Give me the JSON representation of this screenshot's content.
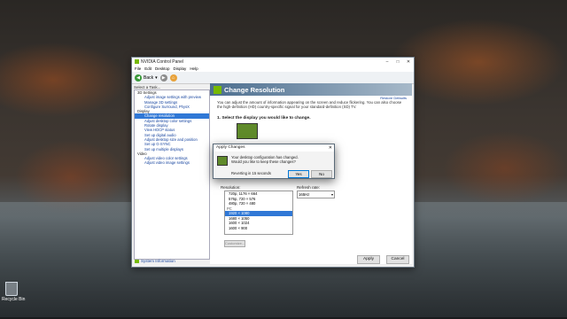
{
  "desktop": {
    "recycle_bin_label": "Recycle Bin"
  },
  "window": {
    "title": "NVIDIA Control Panel",
    "controls": [
      "–",
      "□",
      "✕"
    ],
    "menu": [
      "File",
      "Edit",
      "Desktop",
      "Display",
      "Help"
    ],
    "toolbar": {
      "back_label": "Back"
    },
    "task_label": "Select a Task...",
    "tree": [
      {
        "text": "3D Settings",
        "type": "cat"
      },
      {
        "text": "Adjust image settings with preview",
        "type": "item"
      },
      {
        "text": "Manage 3D settings",
        "type": "item"
      },
      {
        "text": "Configure Surround, PhysX",
        "type": "item"
      },
      {
        "text": "Display",
        "type": "cat"
      },
      {
        "text": "Change resolution",
        "type": "item",
        "selected": true
      },
      {
        "text": "Adjust desktop color settings",
        "type": "item"
      },
      {
        "text": "Rotate display",
        "type": "item"
      },
      {
        "text": "View HDCP status",
        "type": "item"
      },
      {
        "text": "Set up digital audio",
        "type": "item"
      },
      {
        "text": "Adjust desktop size and position",
        "type": "item"
      },
      {
        "text": "Set up G-SYNC",
        "type": "item"
      },
      {
        "text": "Set up multiple displays",
        "type": "item"
      },
      {
        "text": "Video",
        "type": "cat"
      },
      {
        "text": "Adjust video color settings",
        "type": "item"
      },
      {
        "text": "Adjust video image settings",
        "type": "item"
      }
    ],
    "system_info": "System Information",
    "page": {
      "title": "Change Resolution",
      "restore_defaults": "Restore Defaults",
      "description": "You can adjust the amount of information appearing on the screen and reduce flickering. You can also choose the high-definition (HD) country-specific signal for your standard-definition (SD) TV.",
      "step1": "1. Select the display you would like to change.",
      "resolution_label": "Resolution:",
      "refresh_label": "Refresh rate:",
      "refresh_value": "165Hz",
      "resolutions": [
        {
          "text": "720p, 1176 × 664",
          "type": "row"
        },
        {
          "text": "576p, 720 × 576",
          "type": "row"
        },
        {
          "text": "480p, 720 × 480",
          "type": "row"
        },
        {
          "text": "PC",
          "type": "hdr"
        },
        {
          "text": "1920 × 1080",
          "type": "row",
          "selected": true
        },
        {
          "text": "1680 × 1050",
          "type": "row"
        },
        {
          "text": "1600 × 1024",
          "type": "row"
        },
        {
          "text": "1600 × 900",
          "type": "row"
        }
      ],
      "customize_label": "Customize..."
    },
    "apply_label": "Apply",
    "cancel_label": "Cancel"
  },
  "dialog": {
    "title": "Apply Changes",
    "close": "✕",
    "message_line1": "Your desktop configuration has changed.",
    "message_line2": "Would you like to keep these changes?",
    "timer": "Reverting in 15 seconds",
    "yes_label": "Yes",
    "no_label": "No"
  }
}
